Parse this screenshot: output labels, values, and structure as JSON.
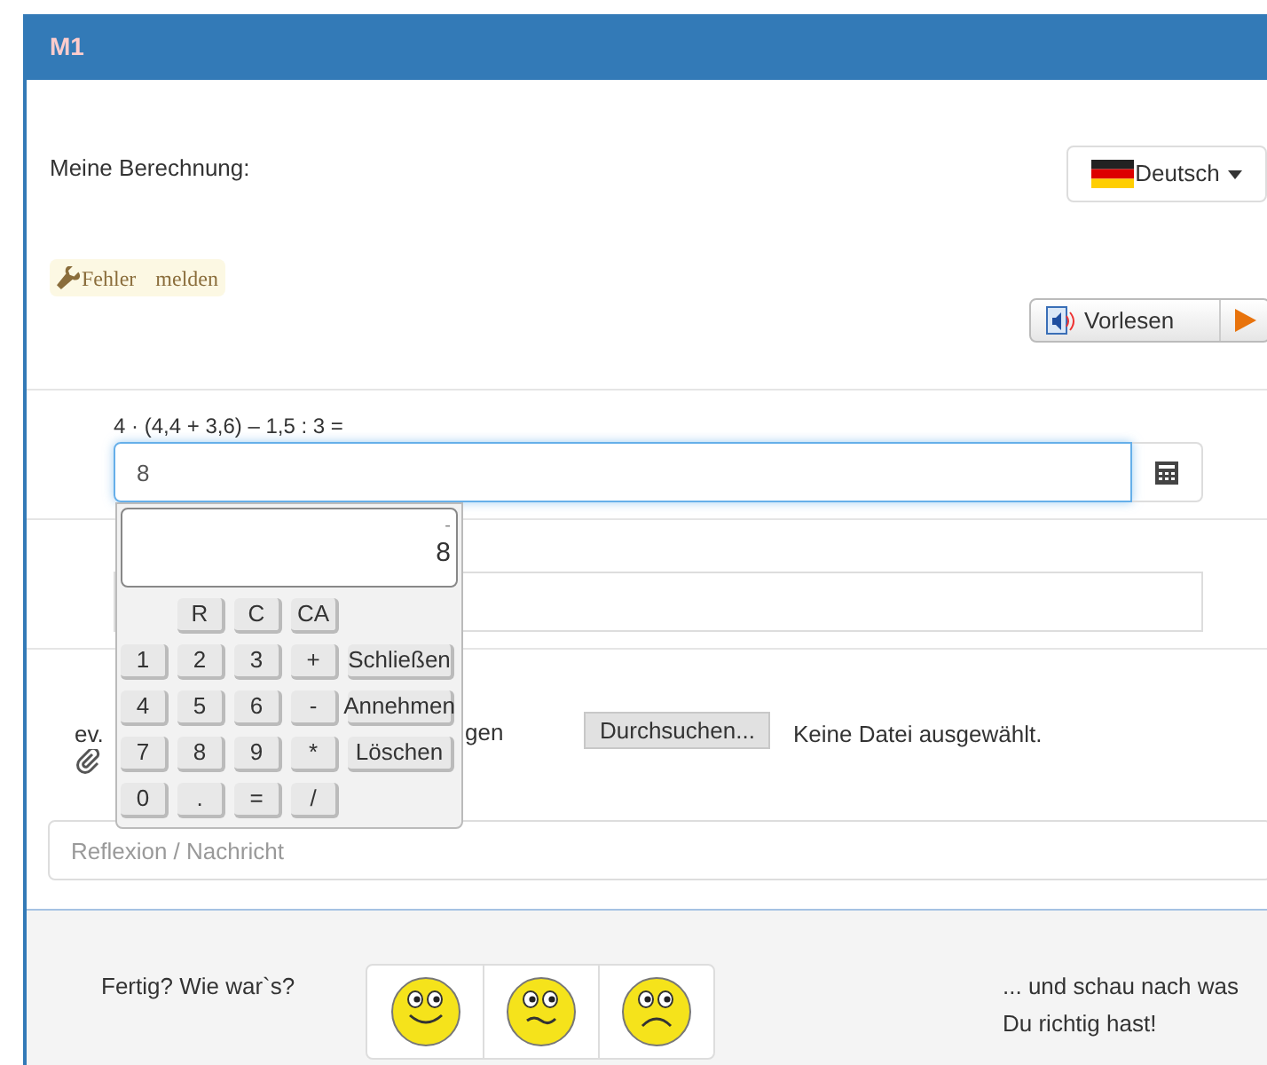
{
  "header": {
    "title": "M1"
  },
  "prompt": "Meine Berechnung:",
  "language_button": {
    "label": "Deutsch"
  },
  "report_badge": {
    "label": "Fehler melden"
  },
  "read_aloud": {
    "label": "Vorlesen"
  },
  "task": {
    "expression": "4 · (4,4 + 3,6) – 1,5 : 3 =",
    "answer": "8"
  },
  "calculator": {
    "display_sign": "-",
    "display_value": "8",
    "rows": [
      [
        "",
        "R",
        "C",
        "CA"
      ],
      [
        "1",
        "2",
        "3",
        "+",
        "Schließen"
      ],
      [
        "4",
        "5",
        "6",
        "-",
        "Annehmen"
      ],
      [
        "7",
        "8",
        "9",
        "*",
        "Löschen"
      ],
      [
        "0",
        ".",
        "=",
        "/"
      ]
    ]
  },
  "attachment": {
    "label_start": "ev.",
    "label_end": "gen",
    "browse_button": "Durchsuchen...",
    "file_status": "Keine Datei ausgewählt."
  },
  "reflection": {
    "placeholder": "Reflexion / Nachricht"
  },
  "footer": {
    "question": "Fertig? Wie war`s?",
    "ratings": [
      {
        "kind": "happy"
      },
      {
        "kind": "neutral"
      },
      {
        "kind": "sad"
      }
    ],
    "hint": "... und schau nach was Du richtig hast!"
  }
}
